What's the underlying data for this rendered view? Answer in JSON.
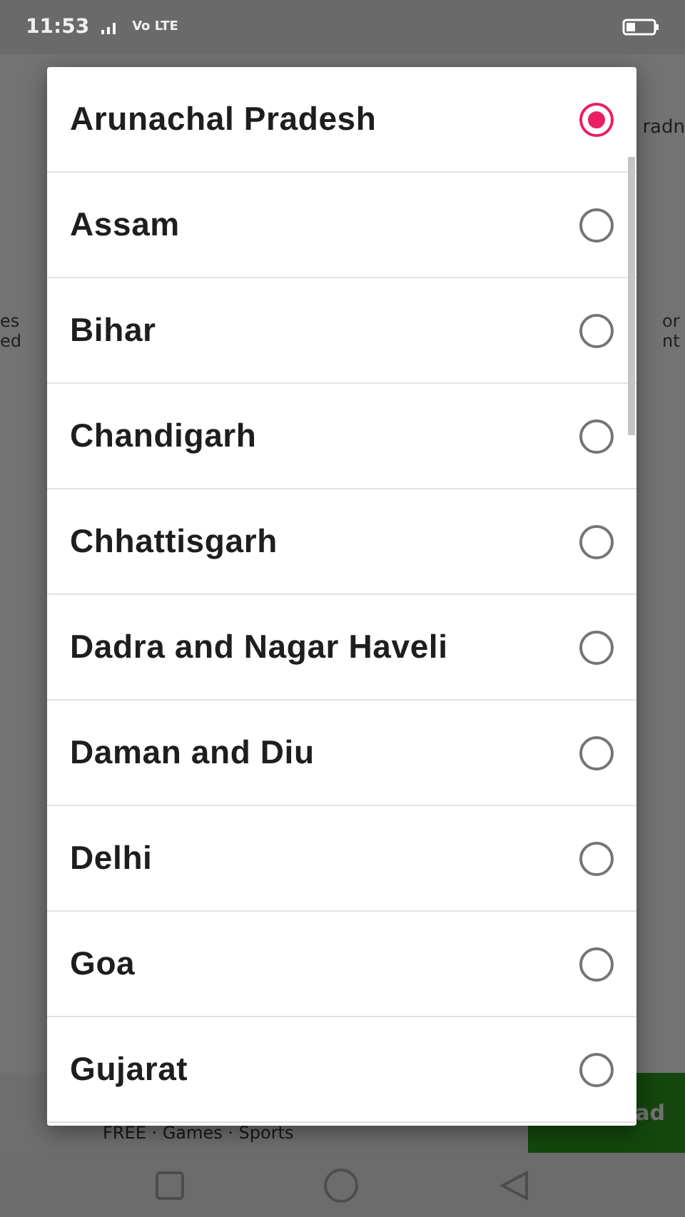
{
  "status_bar": {
    "time": "11:53",
    "network": "Vo LTE"
  },
  "background": {
    "left_fragment": "es ed",
    "right_fragment": "or nt",
    "top_right_fragment": "radn",
    "ad": {
      "subtitle": "FREE · Games · Sports",
      "button": "ad"
    }
  },
  "dialog": {
    "options": [
      {
        "label": "Arunachal Pradesh",
        "selected": true
      },
      {
        "label": "Assam",
        "selected": false
      },
      {
        "label": "Bihar",
        "selected": false
      },
      {
        "label": "Chandigarh",
        "selected": false
      },
      {
        "label": "Chhattisgarh",
        "selected": false
      },
      {
        "label": "Dadra and Nagar Haveli",
        "selected": false
      },
      {
        "label": "Daman and Diu",
        "selected": false
      },
      {
        "label": "Delhi",
        "selected": false
      },
      {
        "label": "Goa",
        "selected": false
      },
      {
        "label": "Gujarat",
        "selected": false
      }
    ]
  }
}
